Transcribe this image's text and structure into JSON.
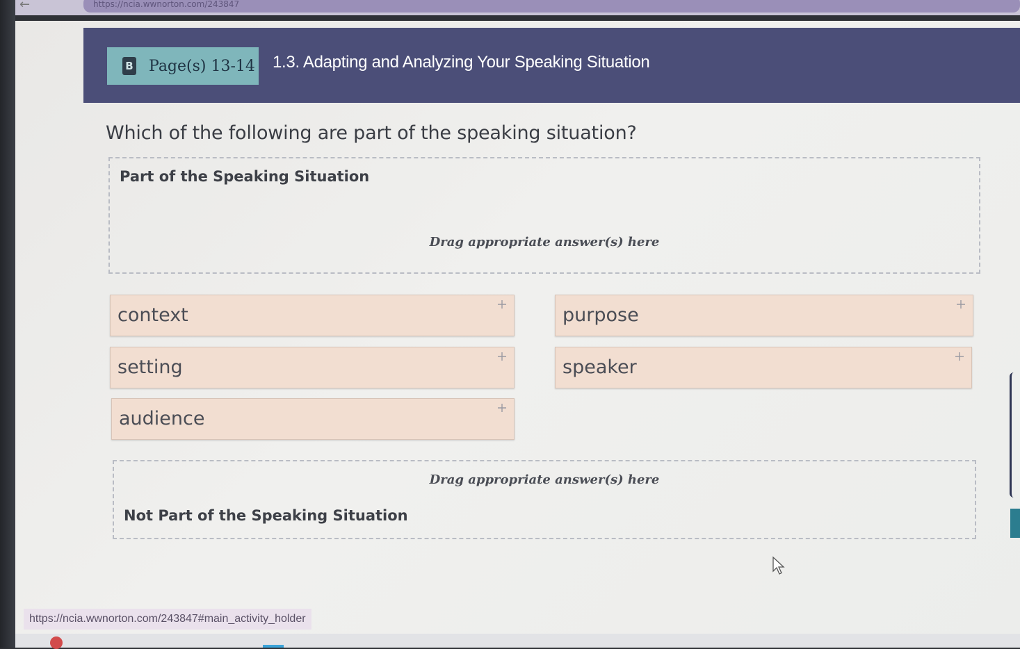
{
  "browser": {
    "url_partial": "https://ncia.wwnorton.com/243847"
  },
  "header": {
    "page_chip_icon": "B",
    "page_chip_label": "Page(s) 13-14",
    "section_title": "1.3. Adapting and Analyzing Your Speaking Situation"
  },
  "question": "Which of the following are part of the speaking situation?",
  "zones": {
    "top": {
      "heading": "Part of the Speaking Situation",
      "hint": "Drag appropriate answer(s) here"
    },
    "bottom": {
      "heading": "Not Part of the Speaking Situation",
      "hint": "Drag appropriate answer(s) here"
    }
  },
  "answers": [
    {
      "label": "context",
      "icon": "move-icon"
    },
    {
      "label": "purpose",
      "icon": "move-icon"
    },
    {
      "label": "setting",
      "icon": "move-icon"
    },
    {
      "label": "speaker",
      "icon": "move-icon"
    },
    {
      "label": "audience",
      "icon": "move-icon"
    }
  ],
  "status_bar": {
    "url": "https://ncia.wwnorton.com/243847#main_activity_holder"
  },
  "colors": {
    "header_band": "#4b4e78",
    "page_chip": "#7fb6bb",
    "tile_bg": "#f2ded1",
    "accent_teal": "#2c7d8f"
  }
}
